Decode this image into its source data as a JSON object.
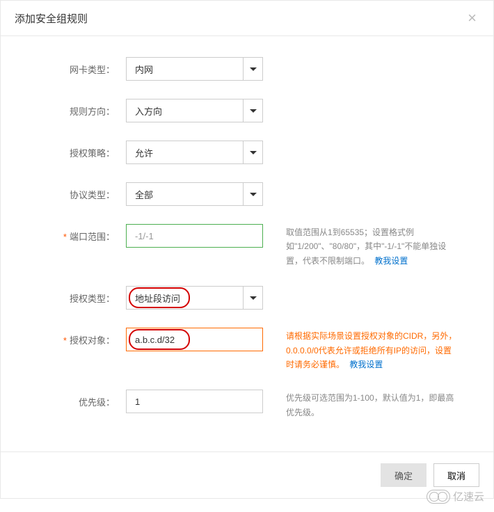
{
  "modal": {
    "title": "添加安全组规则"
  },
  "form": {
    "nic_type": {
      "label": "网卡类型：",
      "value": "内网"
    },
    "direction": {
      "label": "规则方向：",
      "value": "入方向"
    },
    "policy": {
      "label": "授权策略：",
      "value": "允许"
    },
    "protocol": {
      "label": "协议类型：",
      "value": "全部"
    },
    "port": {
      "label": "端口范围：",
      "value": "-1/-1",
      "help": "取值范围从1到65535；设置格式例如\"1/200\"、\"80/80\"，其中\"-1/-1\"不能单独设置，代表不限制端口。",
      "link": "教我设置"
    },
    "auth_type": {
      "label": "授权类型：",
      "value": "地址段访问"
    },
    "auth_object": {
      "label": "授权对象：",
      "value": "a.b.c.d/32",
      "help": "请根据实际场景设置授权对象的CIDR，另外，0.0.0.0/0代表允许或拒绝所有IP的访问，设置时请务必谨慎。",
      "link": "教我设置"
    },
    "priority": {
      "label": "优先级：",
      "value": "1",
      "help": "优先级可选范围为1-100，默认值为1，即最高优先级。"
    }
  },
  "footer": {
    "ok": "确定",
    "cancel": "取消"
  },
  "watermark": "亿速云"
}
